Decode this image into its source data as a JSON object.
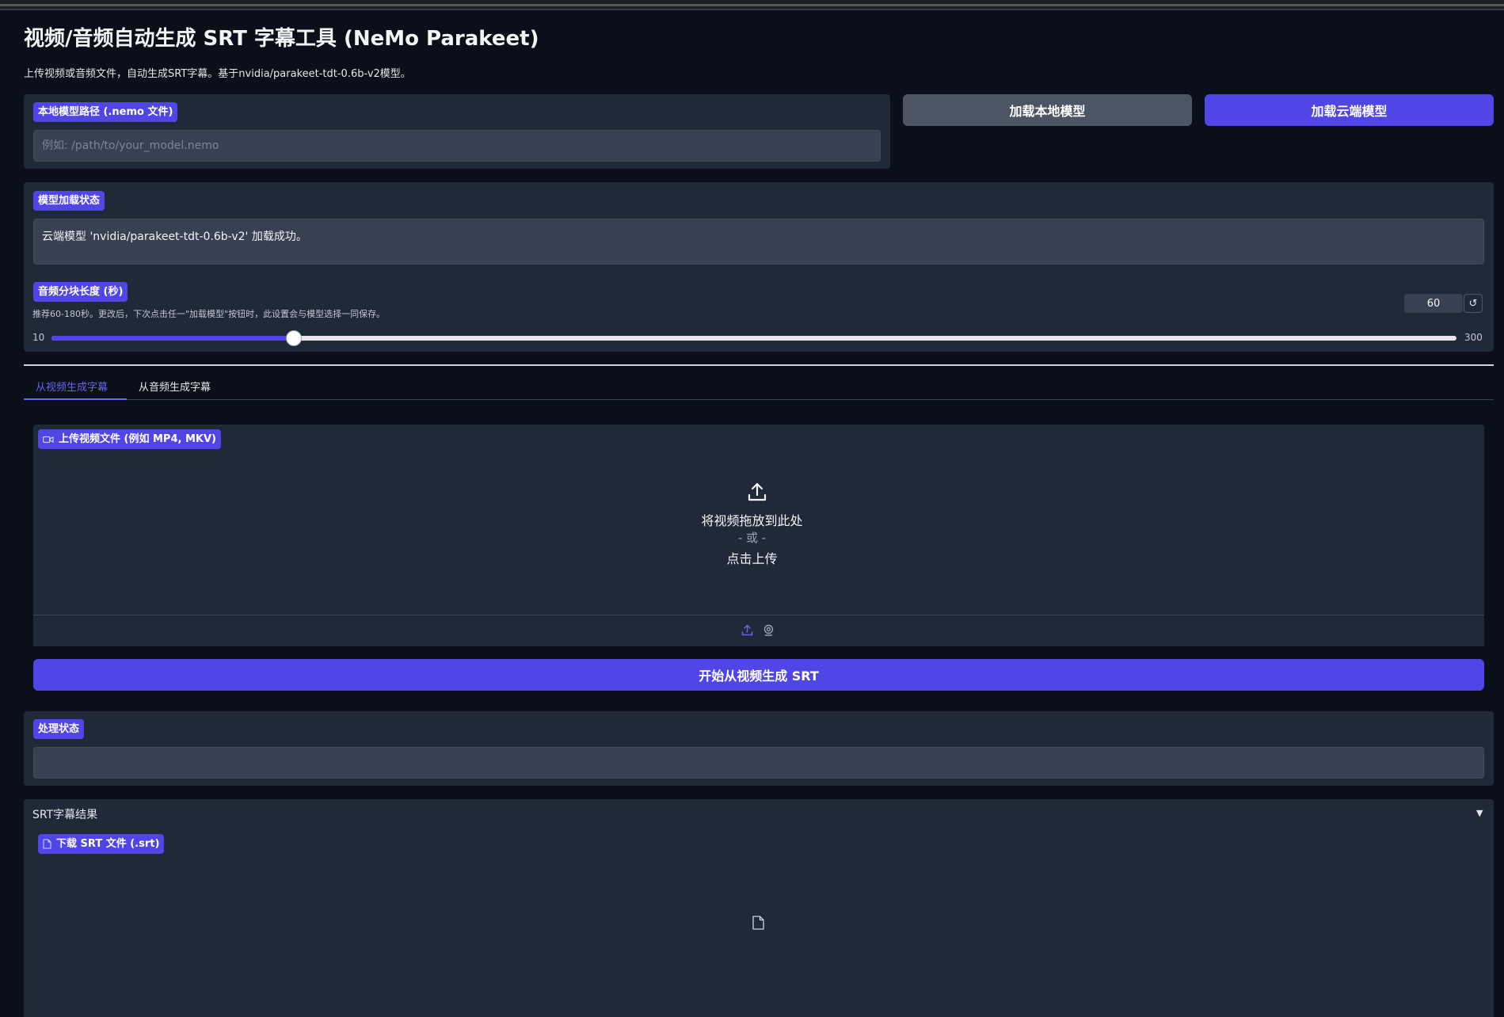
{
  "header": {
    "title": "视频/音频自动生成 SRT 字幕工具 (NeMo Parakeet)",
    "subtitle": "上传视频或音频文件，自动生成SRT字幕。基于nvidia/parakeet-tdt-0.6b-v2模型。"
  },
  "model_path": {
    "label": "本地模型路径 (.nemo 文件)",
    "placeholder": "例如: /path/to/your_model.nemo",
    "value": ""
  },
  "buttons": {
    "load_local": "加载本地模型",
    "load_cloud": "加载云端模型",
    "generate_video": "开始从视频生成 SRT"
  },
  "model_status": {
    "label": "模型加载状态",
    "value": "云端模型 'nvidia/parakeet-tdt-0.6b-v2' 加载成功。"
  },
  "chunk": {
    "label": "音频分块长度 (秒)",
    "info": "推荐60-180秒。更改后，下次点击任一\"加载模型\"按钮时，此设置会与模型选择一同保存。",
    "value": "60",
    "min": "10",
    "max": "300",
    "reset_icon": "↺"
  },
  "tabs": [
    {
      "label": "从视频生成字幕",
      "active": true
    },
    {
      "label": "从音频生成字幕",
      "active": false
    }
  ],
  "video_upload": {
    "label": "上传视频文件 (例如 MP4, MKV)",
    "drop_text": "将视频拖放到此处",
    "or_text": "- 或 -",
    "click_text": "点击上传",
    "icons": [
      "upload-icon",
      "webcam-icon"
    ]
  },
  "process_status": {
    "label": "处理状态",
    "value": ""
  },
  "srt_result": {
    "title": "SRT字幕结果",
    "arrow": "▼",
    "download_label": "下载 SRT 文件 (.srt)"
  },
  "colors": {
    "background": "#0b0f19",
    "panel": "#1f2937",
    "accent": "#4f46e5",
    "input": "#374151"
  }
}
